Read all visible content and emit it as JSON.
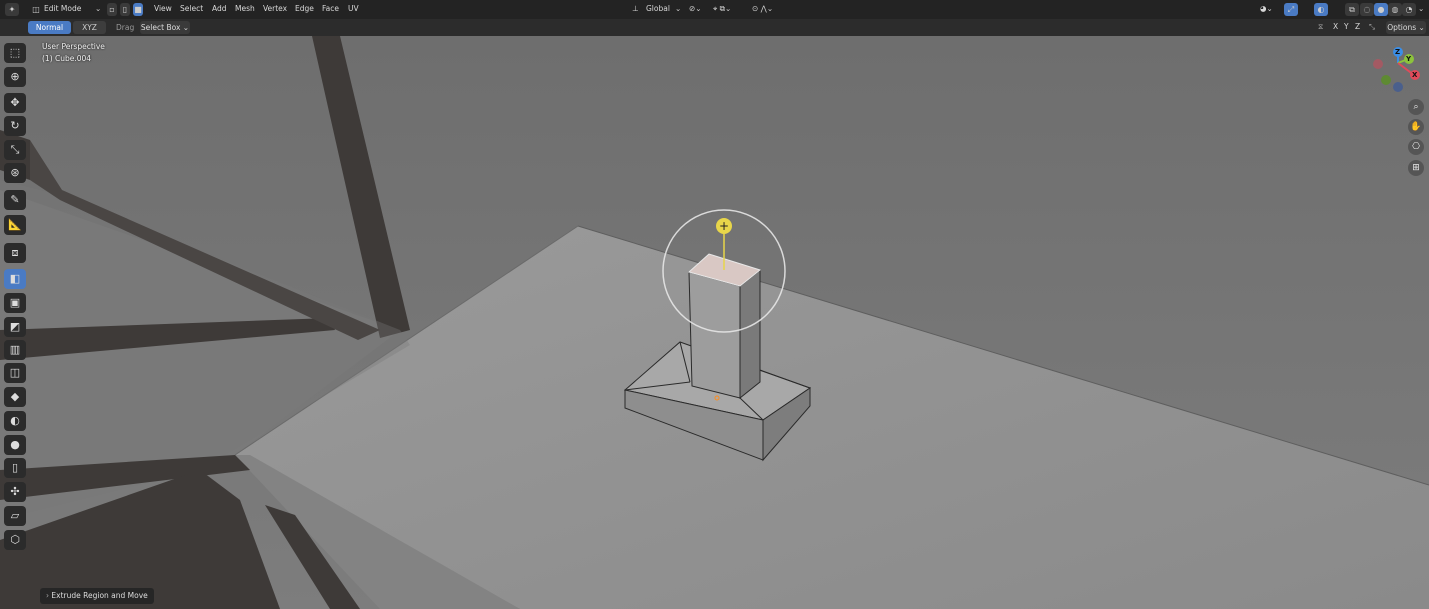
{
  "header": {
    "mode": "Edit Mode",
    "menus": [
      "View",
      "Select",
      "Add",
      "Mesh",
      "Vertex",
      "Edge",
      "Face",
      "UV"
    ],
    "orientation": "Global",
    "options_label": "Options",
    "axes": [
      "X",
      "Y",
      "Z"
    ]
  },
  "tool_settings": {
    "orientation_active": "Normal",
    "constraint": "XYZ",
    "drag_label": "Drag",
    "drag_value": "Select Box"
  },
  "viewport": {
    "perspective": "User Perspective",
    "object": "(1) Cube.004",
    "gizmo_axes": [
      "Z",
      "Y",
      "X"
    ]
  },
  "toolbar": {
    "icons": [
      "select-box-icon",
      "cursor-icon",
      "move-icon",
      "rotate-icon",
      "scale-icon",
      "transform-icon",
      "annotate-icon",
      "measure-icon",
      "add-cube-icon",
      "extrude-region-icon",
      "inset-faces-icon",
      "bevel-icon",
      "loop-cut-icon",
      "knife-icon",
      "poly-build-icon",
      "spin-icon",
      "smooth-icon",
      "edge-slide-icon",
      "shrink-fatten-icon",
      "shear-icon",
      "rip-region-icon"
    ],
    "active": "extrude-region-icon"
  },
  "last_operator": "Extrude Region and Move",
  "colors": {
    "accent": "#4a7bc4",
    "header_bg": "#232323",
    "gizmo_yellow": "#e8d64a",
    "axis_x": "#e04a5a",
    "axis_y": "#8cc43c",
    "axis_z": "#3a8ee8"
  }
}
